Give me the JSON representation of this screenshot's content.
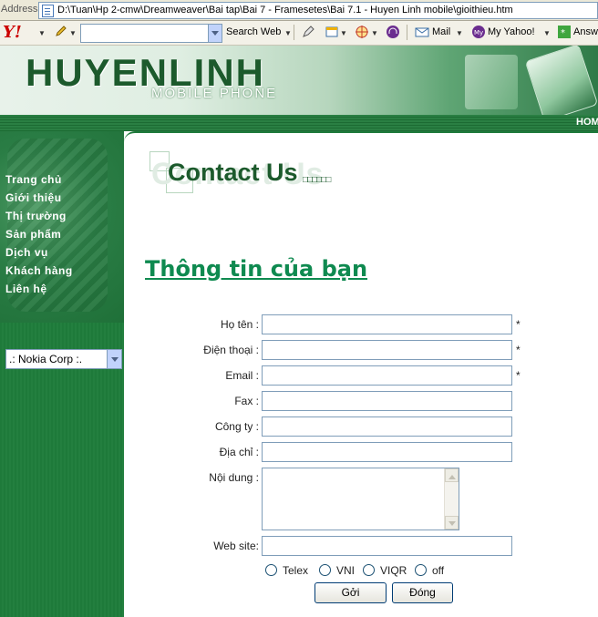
{
  "address_bar": {
    "label": "Address",
    "url": "D:\\Tuan\\Hp 2-cmw\\Dreamweaver\\Bai tap\\Bai 7 - Framesetes\\Bai 7.1 - Huyen Linh mobile\\gioithieu.htm"
  },
  "yahoo_toolbar": {
    "logo": "Y!",
    "search_value": "",
    "search_button": "Search Web",
    "mail": "Mail",
    "my_yahoo": "My Yahoo!",
    "answers": "Answ"
  },
  "banner": {
    "brand": "HUYENLINH",
    "subtitle": "MOBILE PHONE",
    "home_link": "HOM"
  },
  "nav": {
    "items": [
      "Trang chủ",
      "Giới thiệu",
      "Thị trường",
      "Sản phẩm",
      "Dịch vụ",
      "Khách hàng",
      "Liên hệ"
    ],
    "select_value": ".: Nokia Corp :."
  },
  "content": {
    "contact_title": "Contact Us",
    "contact_ghost": "Contact Us",
    "contact_squares": "□□□□□□",
    "section_title": "Thông tin của bạn"
  },
  "form": {
    "fields": [
      {
        "label": "Họ tên :",
        "value": "",
        "required": "*"
      },
      {
        "label": "Điện thoại :",
        "value": "",
        "required": "*"
      },
      {
        "label": "Email :",
        "value": "",
        "required": "*"
      },
      {
        "label": "Fax :",
        "value": "",
        "required": ""
      },
      {
        "label": "Công ty :",
        "value": "",
        "required": ""
      },
      {
        "label": "Địa chỉ :",
        "value": "",
        "required": ""
      }
    ],
    "message_label": "Nội dung :",
    "message_value": "",
    "website_label": "Web site:",
    "website_value": "",
    "input_modes": [
      "Telex",
      "VNI",
      "VIQR",
      "off"
    ],
    "submit_label": "Gởi",
    "close_label": "Đóng"
  },
  "colors": {
    "brand_green": "#1c5a2c",
    "nav_green": "#1f7a3c",
    "heading_green": "#0f8a50"
  }
}
